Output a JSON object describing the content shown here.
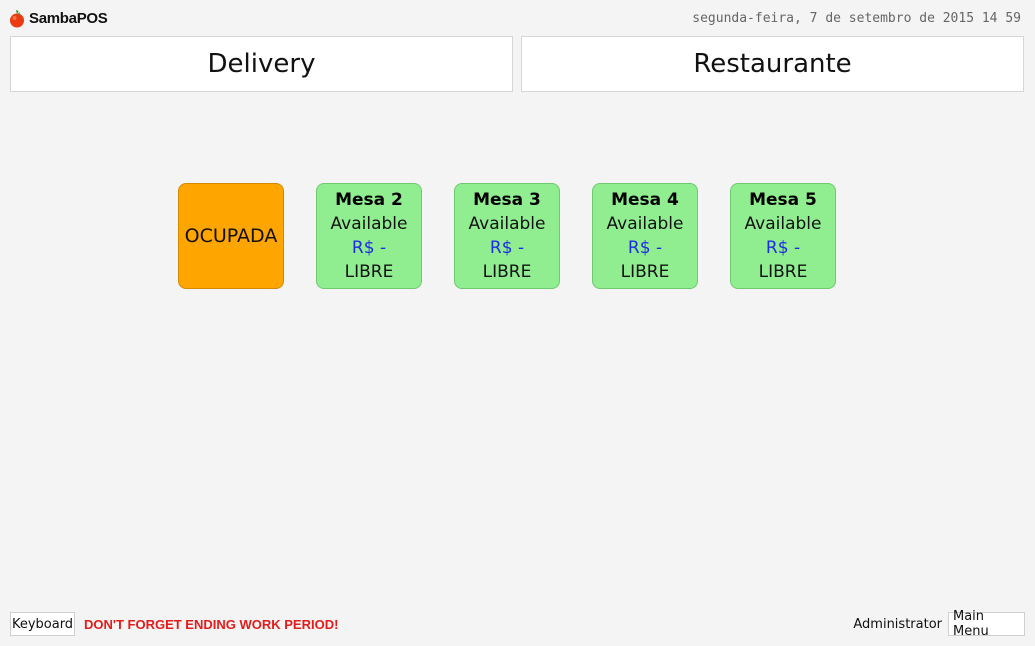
{
  "header": {
    "app_name": "SambaPOS",
    "logo_icon": "tomato-icon",
    "datetime": "segunda-feira, 7 de setembro de 2015 14 59"
  },
  "departments": [
    {
      "label": "Delivery"
    },
    {
      "label": "Restaurante"
    }
  ],
  "tables": [
    {
      "status": "occupied",
      "label": "OCUPADA",
      "color": "#ffa500"
    },
    {
      "status": "free",
      "name": "Mesa 2",
      "state": "Available",
      "price": "R$ -",
      "tag": "LIBRE",
      "color": "#90ee90"
    },
    {
      "status": "free",
      "name": "Mesa 3",
      "state": "Available",
      "price": "R$ -",
      "tag": "LIBRE",
      "color": "#90ee90"
    },
    {
      "status": "free",
      "name": "Mesa 4",
      "state": "Available",
      "price": "R$ -",
      "tag": "LIBRE",
      "color": "#90ee90"
    },
    {
      "status": "free",
      "name": "Mesa 5",
      "state": "Available",
      "price": "R$ -",
      "tag": "LIBRE",
      "color": "#90ee90"
    }
  ],
  "footer": {
    "keyboard_label": "Keyboard",
    "warning": "DON'T FORGET ENDING WORK PERIOD!",
    "warning_color": "#e31b1b",
    "user": "Administrator",
    "main_menu_label": "Main Menu"
  }
}
